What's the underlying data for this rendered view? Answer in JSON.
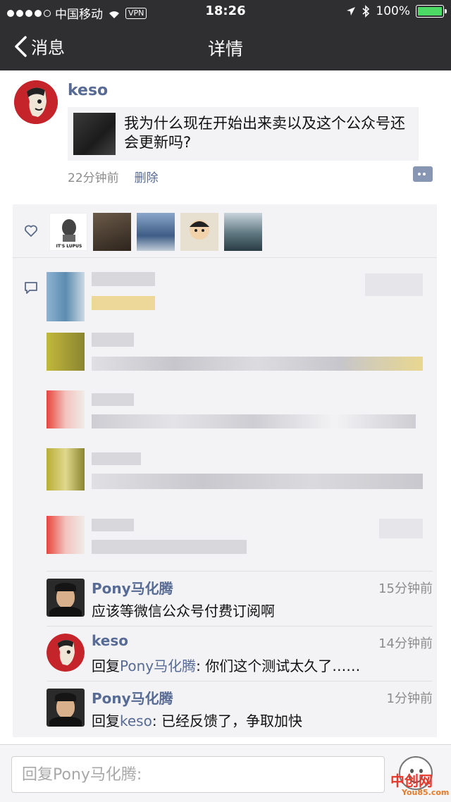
{
  "status_bar": {
    "carrier": "中国移动",
    "vpn": "VPN",
    "time": "18:26",
    "battery": "100%"
  },
  "nav": {
    "back_label": "消息",
    "title": "详情"
  },
  "post": {
    "author": "keso",
    "share_text": "我为什么现在开始出来卖以及这个公众号还会更新吗?",
    "time": "22分钟前",
    "delete_label": "删除"
  },
  "likes": {
    "avatar_caption": "IT'S LUPUS"
  },
  "comments": [
    {
      "name": "Pony马化腾",
      "time": "15分钟前",
      "text": "应该等微信公众号付费订阅啊"
    },
    {
      "name": "keso",
      "time": "14分钟前",
      "reply_prefix": "回复",
      "reply_to": "Pony马化腾",
      "text": ": 你们这个测试太久了……"
    },
    {
      "name": "Pony马化腾",
      "time": "1分钟前",
      "reply_prefix": "回复",
      "reply_to": "keso",
      "text": ": 已经反馈了，争取加快"
    }
  ],
  "reply_box": {
    "placeholder": "回复Pony马化腾:"
  },
  "watermark": {
    "title": "中创网",
    "site": "You85.com"
  },
  "colors": {
    "nav_bg": "#2f2f31",
    "link": "#576b95",
    "panel_bg": "#f3f3f5",
    "battery": "#4cd964"
  }
}
